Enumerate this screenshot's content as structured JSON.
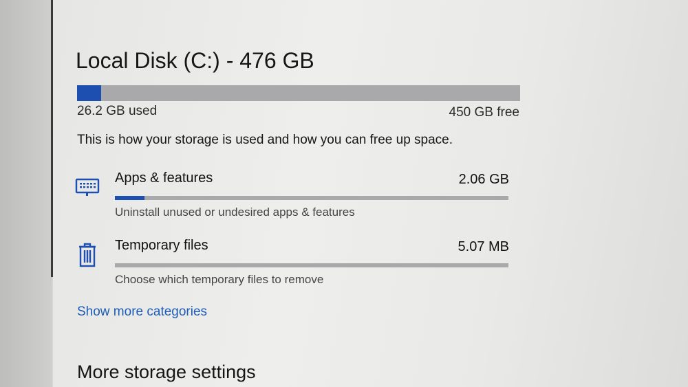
{
  "disk": {
    "title": "Local Disk (C:) - 476 GB",
    "used_label": "26.2 GB used",
    "free_label": "450 GB free",
    "used_fraction": 0.055
  },
  "intro": "This is how your storage is used and how you can free up space.",
  "categories": [
    {
      "name": "Apps & features",
      "size": "2.06 GB",
      "description": "Uninstall unused or undesired apps & features",
      "icon": "keyboard-icon",
      "fill_fraction": 0.075
    },
    {
      "name": "Temporary files",
      "size": "5.07 MB",
      "description": "Choose which temporary files to remove",
      "icon": "trash-icon",
      "fill_fraction": 0.0
    }
  ],
  "show_more": "Show more categories",
  "more_settings_heading": "More storage settings",
  "colors": {
    "accent": "#1c4fb0",
    "link": "#1e5db6",
    "bar_track": "#a9a9ab"
  }
}
